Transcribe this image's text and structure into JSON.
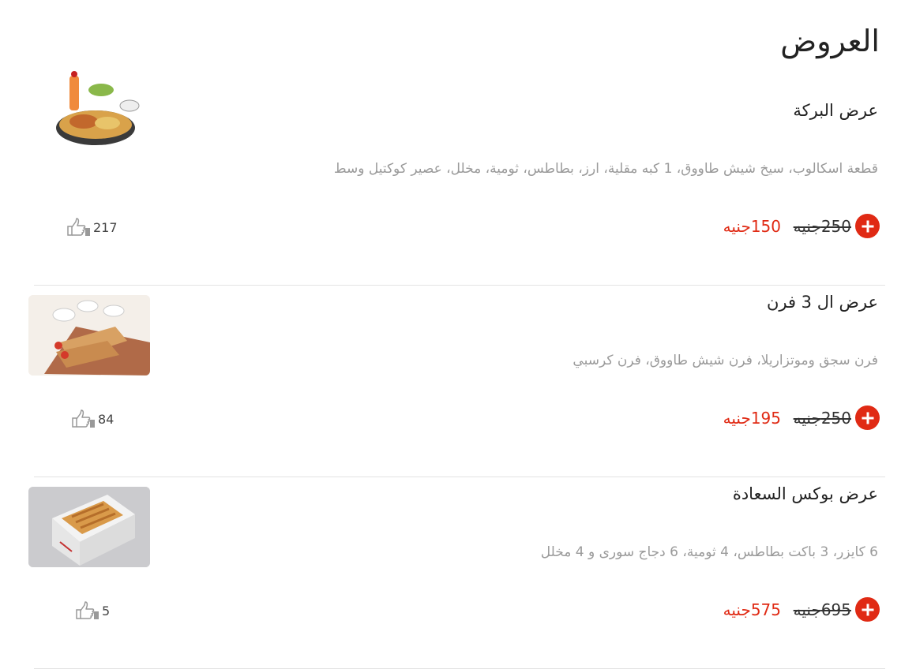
{
  "page": {
    "title": "العروض"
  },
  "offers": [
    {
      "name": "عرض البركة",
      "description": "قطعة اسكالوب، سيخ شيش طاووق، 1 كبه مقلية، ارز، بطاطس، ثومية، مخلل، عصير كوكتيل وسط",
      "old_price": "250جنيه",
      "new_price": "150جنيه",
      "likes": "217",
      "image_icon": "food-platter-icon"
    },
    {
      "name": "عرض ال 3 فرن",
      "description": "فرن سجق وموتزاريلا، فرن شيش طاووق، فرن كرسبي",
      "old_price": "250جنيه",
      "new_price": "195جنيه",
      "likes": "84",
      "image_icon": "wraps-platter-icon"
    },
    {
      "name": "عرض بوكس السعادة",
      "description": "6 كايزر، 3 باكت بطاطس، 4 ثومية، 6 دجاج سورى و 4 مخلل",
      "old_price": "695جنيه",
      "new_price": "575جنيه",
      "likes": "5",
      "image_icon": "food-box-icon"
    }
  ],
  "colors": {
    "accent": "#e02a14",
    "text": "#222222",
    "muted": "#9a9a9a",
    "divider": "#e3e3e3"
  }
}
